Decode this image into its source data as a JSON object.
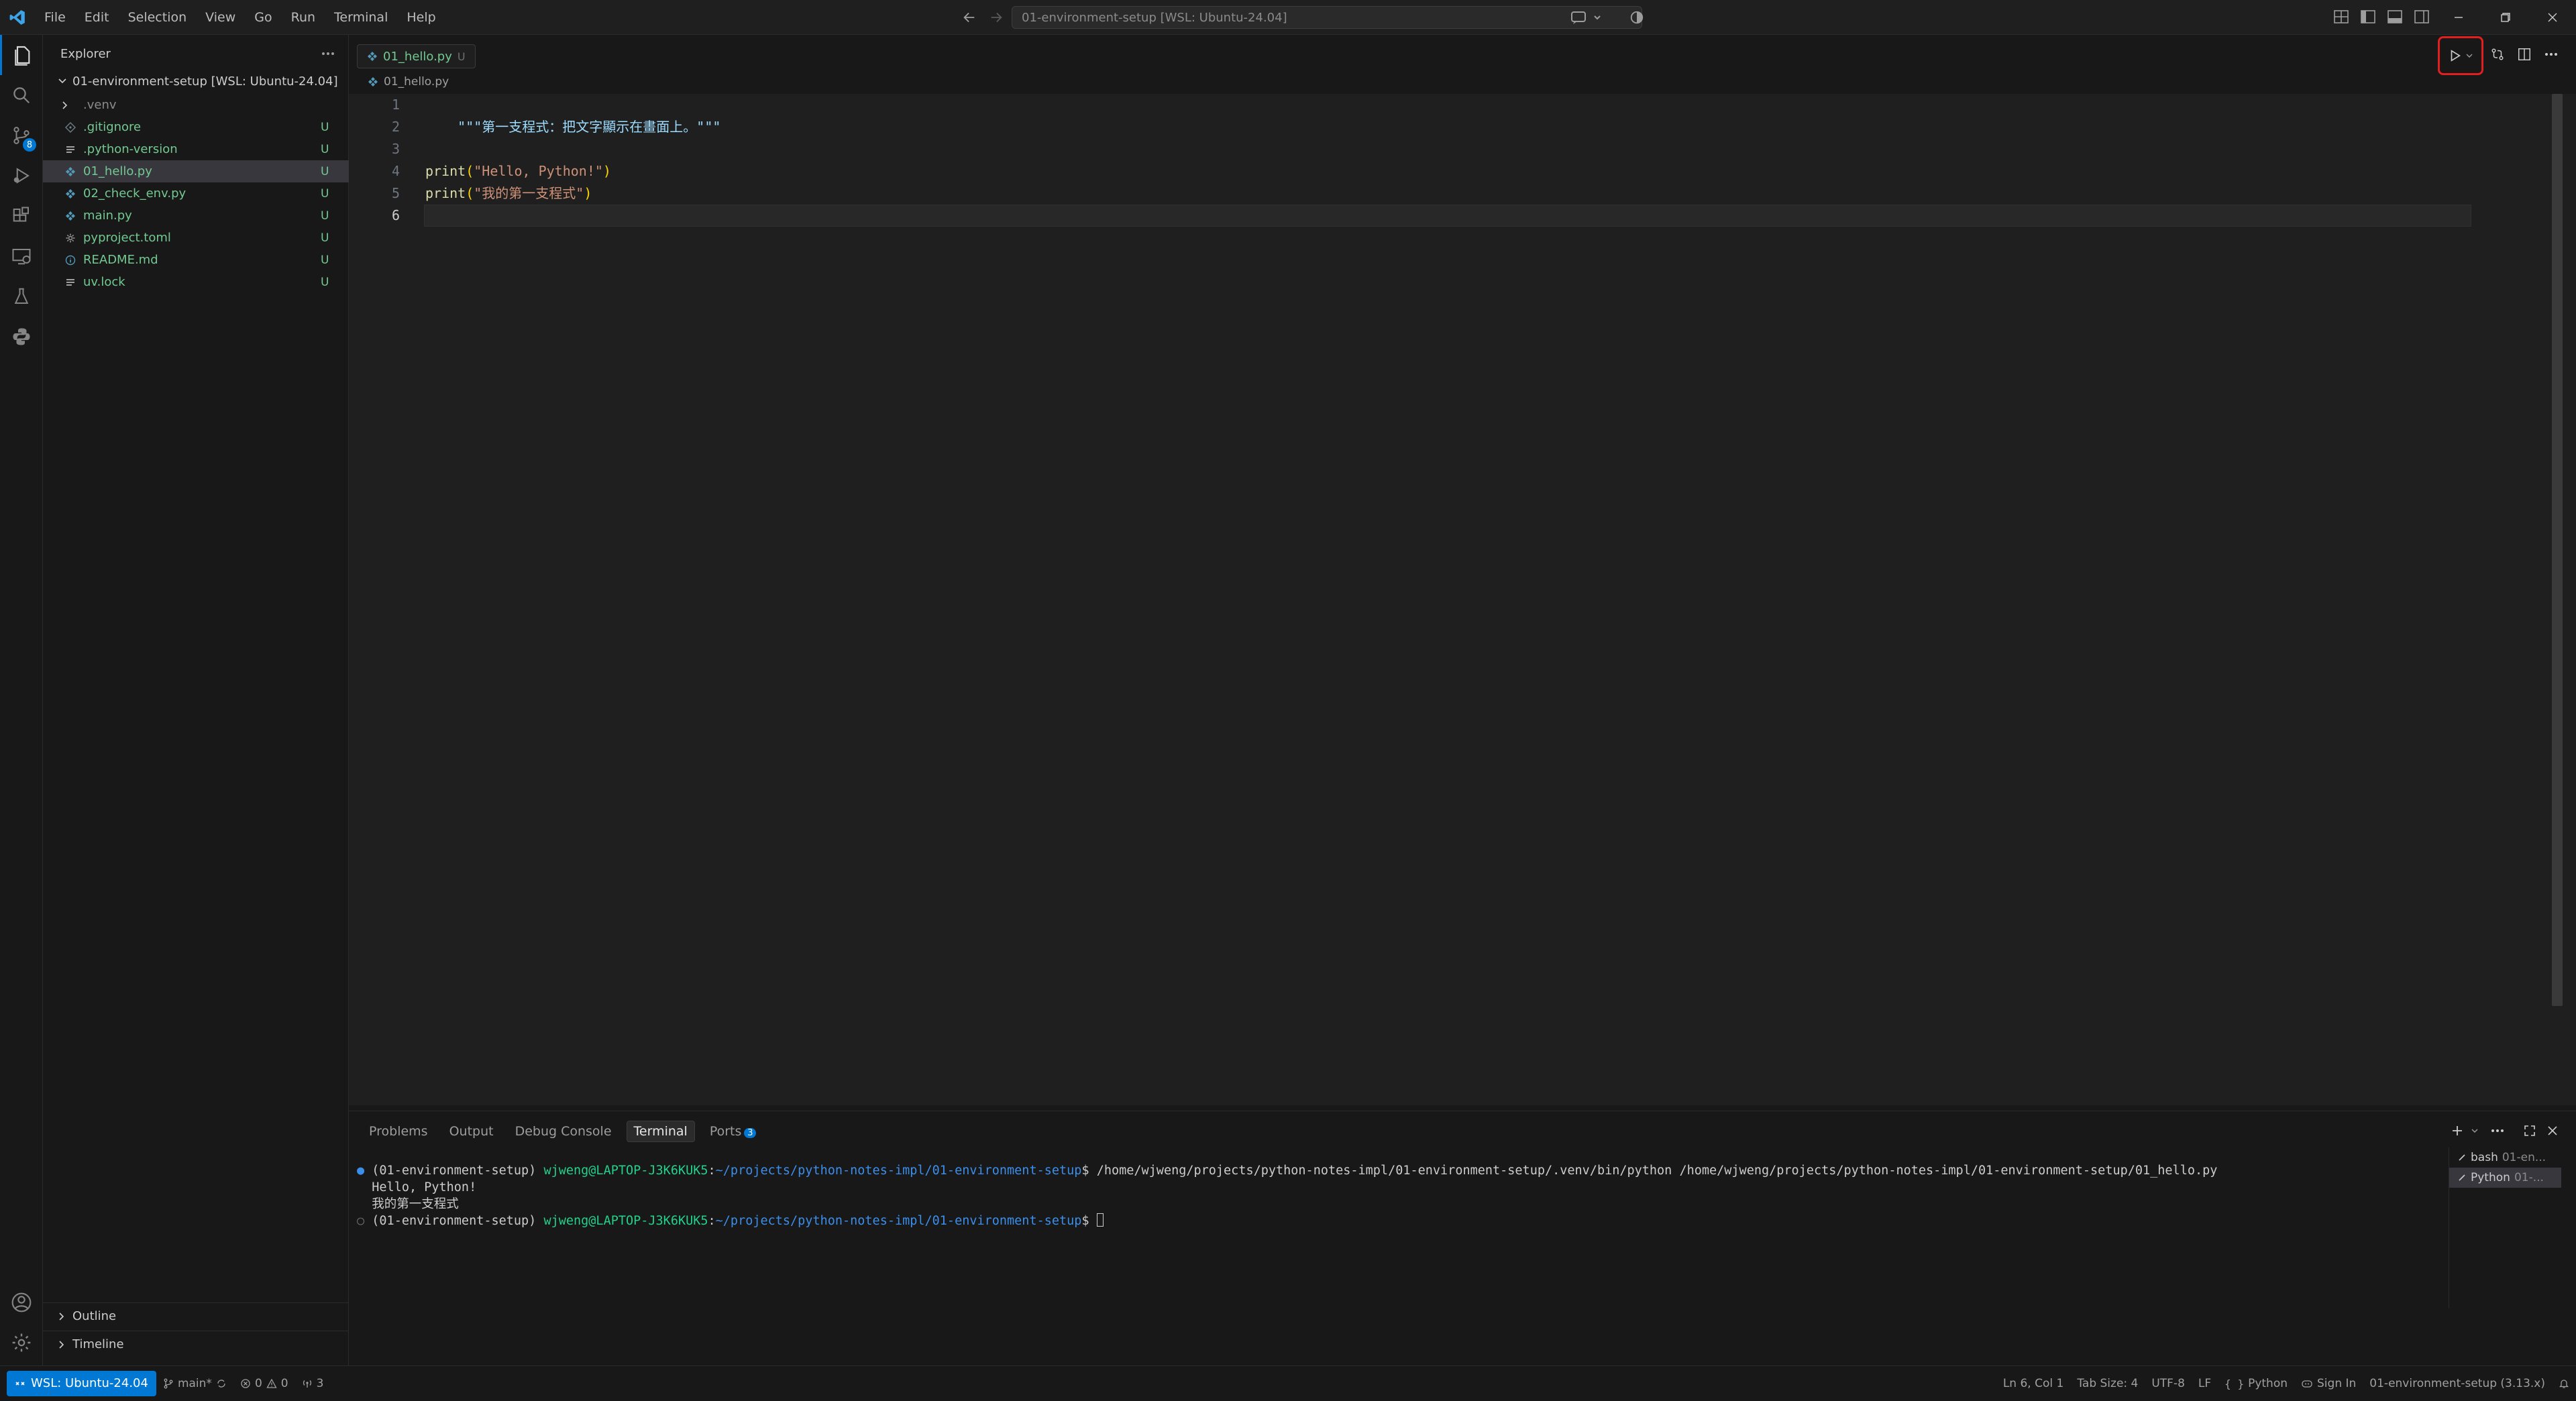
{
  "titlebar": {
    "menu": [
      "File",
      "Edit",
      "Selection",
      "View",
      "Go",
      "Run",
      "Terminal",
      "Help"
    ],
    "search_text": "01-environment-setup [WSL: Ubuntu-24.04]"
  },
  "activity": {
    "scm_badge": "8"
  },
  "explorer": {
    "title": "Explorer",
    "workspace": "01-environment-setup [WSL: Ubuntu-24.04]",
    "items": [
      {
        "name": ".venv",
        "status": "",
        "icon": "chevron-right",
        "color": "#8b8b8b"
      },
      {
        "name": ".gitignore",
        "status": "U",
        "icon": "git",
        "color": "#73c991"
      },
      {
        "name": ".python-version",
        "status": "U",
        "icon": "lines",
        "color": "#73c991"
      },
      {
        "name": "01_hello.py",
        "status": "U",
        "icon": "python",
        "color": "#73c991"
      },
      {
        "name": "02_check_env.py",
        "status": "U",
        "icon": "python",
        "color": "#73c991"
      },
      {
        "name": "main.py",
        "status": "U",
        "icon": "python",
        "color": "#73c991"
      },
      {
        "name": "pyproject.toml",
        "status": "U",
        "icon": "gear",
        "color": "#73c991"
      },
      {
        "name": "README.md",
        "status": "U",
        "icon": "info",
        "color": "#73c991"
      },
      {
        "name": "uv.lock",
        "status": "U",
        "icon": "lines",
        "color": "#73c991"
      }
    ],
    "outline": "Outline",
    "timeline": "Timeline"
  },
  "editor": {
    "tab_label": "01_hello.py",
    "tab_status": "U",
    "breadcrumb": "01_hello.py",
    "line_numbers": [
      "1",
      "2",
      "3",
      "4",
      "5",
      "6"
    ],
    "lines": {
      "l1": "\"\"\"第一支程式：把文字顯示在畫面上。\"\"\"",
      "l4_fn": "print",
      "l4_open": "(",
      "l4_str": "\"Hello, Python!\"",
      "l4_close": ")",
      "l5_fn": "print",
      "l5_open": "(",
      "l5_str": "\"我的第一支程式\"",
      "l5_close": ")"
    }
  },
  "panel": {
    "tabs": [
      "Problems",
      "Output",
      "Debug Console",
      "Terminal",
      "Ports"
    ],
    "ports_badge": "3",
    "terminal": {
      "line1_env": "(01-environment-setup) ",
      "line1_user": "wjweng@LAPTOP-J3K6KUK5",
      "line1_colon": ":",
      "line1_path": "~/projects/python-notes-impl/01-environment-setup",
      "line1_cmd": "$ /home/wjweng/projects/python-notes-impl/01-environment-setup/.venv/bin/python /home/wjweng/projects/python-notes-impl/01-environment-setup/01_hello.py",
      "line2": "Hello, Python!",
      "line3": "我的第一支程式",
      "line4_env": "(01-environment-setup) ",
      "line4_user": "wjweng@LAPTOP-J3K6KUK5",
      "line4_colon": ":",
      "line4_path": "~/projects/python-notes-impl/01-environment-setup",
      "line4_prompt": "$ "
    },
    "terminal_list": [
      {
        "name": "bash",
        "sub": "01-en..."
      },
      {
        "name": "Python",
        "sub": "01-..."
      }
    ]
  },
  "statusbar": {
    "remote": "WSL: Ubuntu-24.04",
    "branch": "main*",
    "errors": "0",
    "warnings": "0",
    "ports": "3",
    "position": "Ln 6, Col 1",
    "tabsize": "Tab Size: 4",
    "encoding": "UTF-8",
    "eol": "LF",
    "language": "Python",
    "signin": "Sign In",
    "interpreter": "01-environment-setup (3.13.x)"
  },
  "colors": {
    "accent": "#0078d4",
    "untracked": "#73c991",
    "highlight_box": "#e02020"
  }
}
